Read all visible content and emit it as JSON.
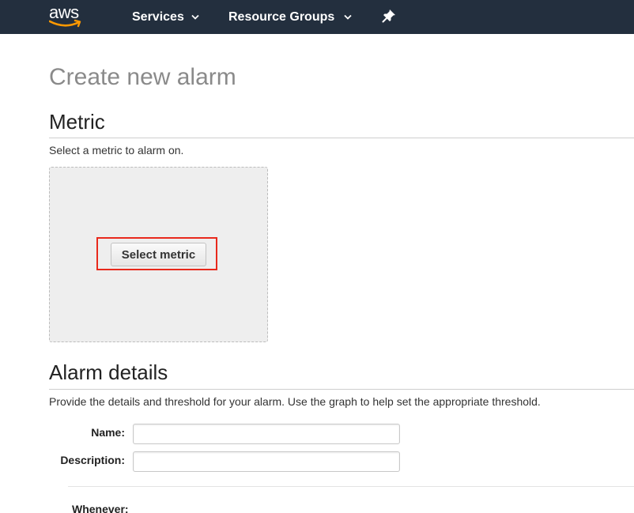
{
  "topbar": {
    "logo_text": "aws",
    "services_label": "Services",
    "resource_groups_label": "Resource Groups",
    "pin_icon": "pushpin-icon"
  },
  "page": {
    "title": "Create new alarm"
  },
  "metric_section": {
    "title": "Metric",
    "description": "Select a metric to alarm on.",
    "select_button_label": "Select metric"
  },
  "alarm_section": {
    "title": "Alarm details",
    "description": "Provide the details and threshold for your alarm. Use the graph to help set the appropriate threshold.",
    "name_label": "Name:",
    "name_value": "",
    "description_label": "Description:",
    "description_value": "",
    "whenever_label": "Whenever:"
  },
  "colors": {
    "topbar_bg": "#232f3e",
    "aws_smile": "#ff9900",
    "highlight": "#e8291c"
  }
}
